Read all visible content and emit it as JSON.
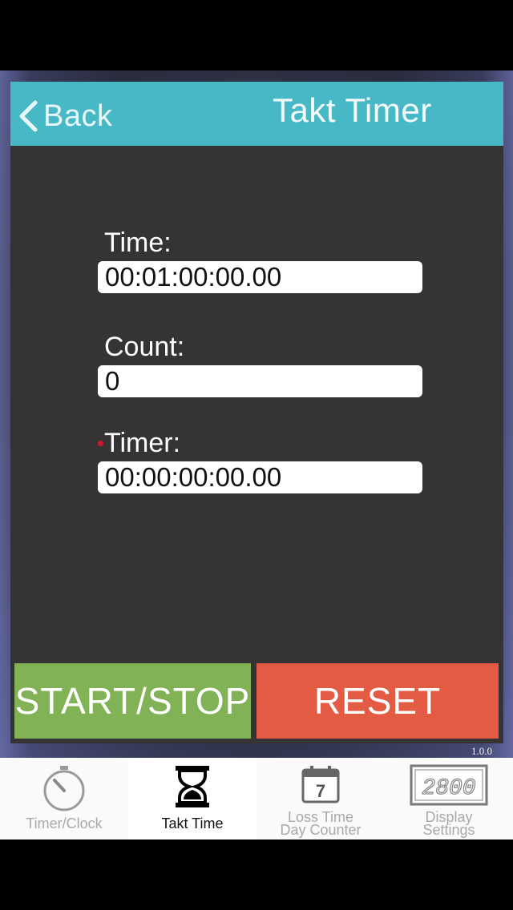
{
  "header": {
    "back_label": "Back",
    "title": "Takt Timer",
    "color": "#47b9c6"
  },
  "fields": {
    "time_label": "Time:",
    "time_value": "00:01:00:00.00",
    "count_label": "Count:",
    "count_value": "0",
    "timer_label": "Timer:",
    "timer_value": "00:00:00:00.00"
  },
  "buttons": {
    "start_stop": "START/STOP",
    "start_color": "#81b255",
    "reset": "RESET",
    "reset_color": "#e25b42"
  },
  "version": "1.0.0",
  "tabbar": {
    "active": "Takt Time",
    "tabs": [
      {
        "label": "Timer/Clock",
        "icon": "stopwatch-icon"
      },
      {
        "label": "Takt Time",
        "icon": "hourglass-icon"
      },
      {
        "label_line1": "Loss Time",
        "label_line2": "Day Counter",
        "icon": "calendar-icon",
        "icon_text": "7"
      },
      {
        "label_line1": "Display",
        "label_line2": "Settings",
        "icon": "segment-display-icon",
        "icon_text": "2800"
      }
    ]
  }
}
